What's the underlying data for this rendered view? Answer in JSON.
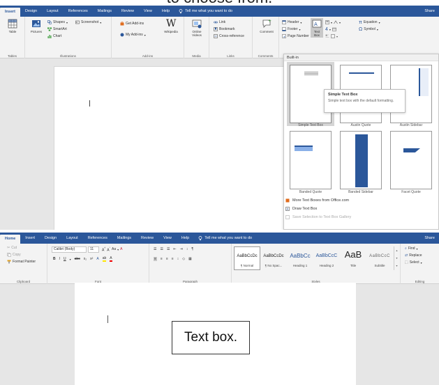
{
  "caption": "to choose from.",
  "insert_screen": {
    "tabs": [
      {
        "label": "Insert",
        "active": true
      },
      {
        "label": "Design"
      },
      {
        "label": "Layout"
      },
      {
        "label": "References"
      },
      {
        "label": "Mailings"
      },
      {
        "label": "Review"
      },
      {
        "label": "View"
      },
      {
        "label": "Help"
      }
    ],
    "tellme": "Tell me what you want to do",
    "share": "Share",
    "groups": {
      "tables": {
        "label": "Tables",
        "table": "Table"
      },
      "illustrations": {
        "label": "Illustrations",
        "pictures": "Pictures",
        "shapes": "Shapes",
        "screenshot": "Screenshot",
        "smartart": "SmartArt",
        "chart": "Chart"
      },
      "addins": {
        "label": "Add-ins",
        "get": "Get Add-ins",
        "my": "My Add-ins",
        "wikipedia": "Wikipedia"
      },
      "media": {
        "label": "Media",
        "online_videos_1": "Online",
        "online_videos_2": "Videos"
      },
      "links": {
        "label": "Links",
        "link": "Link",
        "bookmark": "Bookmark",
        "cross": "Cross-reference"
      },
      "comments": {
        "label": "Comments",
        "comment": "Comment"
      },
      "header_footer": {
        "header": "Header",
        "footer": "Footer",
        "page_number": "Page Number"
      },
      "text": {
        "text_box_1": "Text",
        "text_box_2": "Box"
      },
      "symbols": {
        "equation": "Equation",
        "symbol": "Symbol"
      }
    },
    "gallery": {
      "heading": "Built-in",
      "items": [
        {
          "label": "Simple Text Box"
        },
        {
          "label": "Austin Quote"
        },
        {
          "label": "Austin Sidebar"
        },
        {
          "label": "Banded Quote"
        },
        {
          "label": "Banded Sidebar"
        },
        {
          "label": "Facet Quote"
        }
      ],
      "tooltip": {
        "title": "Simple Text Box",
        "body": "Simple text box with the default formatting."
      },
      "menu": [
        {
          "label": "More Text Boxes from Office.com",
          "disabled": false
        },
        {
          "label": "Draw Text Box",
          "disabled": false
        },
        {
          "label": "Save Selection to Text Box Gallery",
          "disabled": true
        }
      ]
    }
  },
  "home_screen": {
    "tabs": [
      {
        "label": "Home",
        "active": true
      },
      {
        "label": "Insert"
      },
      {
        "label": "Design"
      },
      {
        "label": "Layout"
      },
      {
        "label": "References"
      },
      {
        "label": "Mailings"
      },
      {
        "label": "Review"
      },
      {
        "label": "View"
      },
      {
        "label": "Help"
      }
    ],
    "tellme": "Tell me what you want to do",
    "share": "Share",
    "clipboard": {
      "cut": "Cut",
      "copy": "Copy",
      "format_painter": "Format Painter",
      "label": "Clipboard"
    },
    "font": {
      "name": "Calibri (Body)",
      "size": "11",
      "label": "Font"
    },
    "paragraph": {
      "label": "Paragraph"
    },
    "styles": {
      "label": "Styles",
      "items": [
        {
          "preview": "AaBbCcDc",
          "name": "¶ Normal",
          "selected": true
        },
        {
          "preview": "AaBbCcDc",
          "name": "¶ No Spac..."
        },
        {
          "preview": "AaBbCc",
          "name": "Heading 1"
        },
        {
          "preview": "AaBbCcC",
          "name": "Heading 2"
        },
        {
          "preview": "AaB",
          "name": "Title"
        },
        {
          "preview": "AaBbCcC",
          "name": "Subtitle"
        }
      ]
    },
    "editing": {
      "find": "Find",
      "replace": "Replace",
      "select": "Select",
      "label": "Editing"
    },
    "text_box_content": "Text box."
  },
  "colors": {
    "accent": "#2b579a",
    "ribbon_bg": "#f3f3f3",
    "doc_bg": "#e6e6e6"
  }
}
